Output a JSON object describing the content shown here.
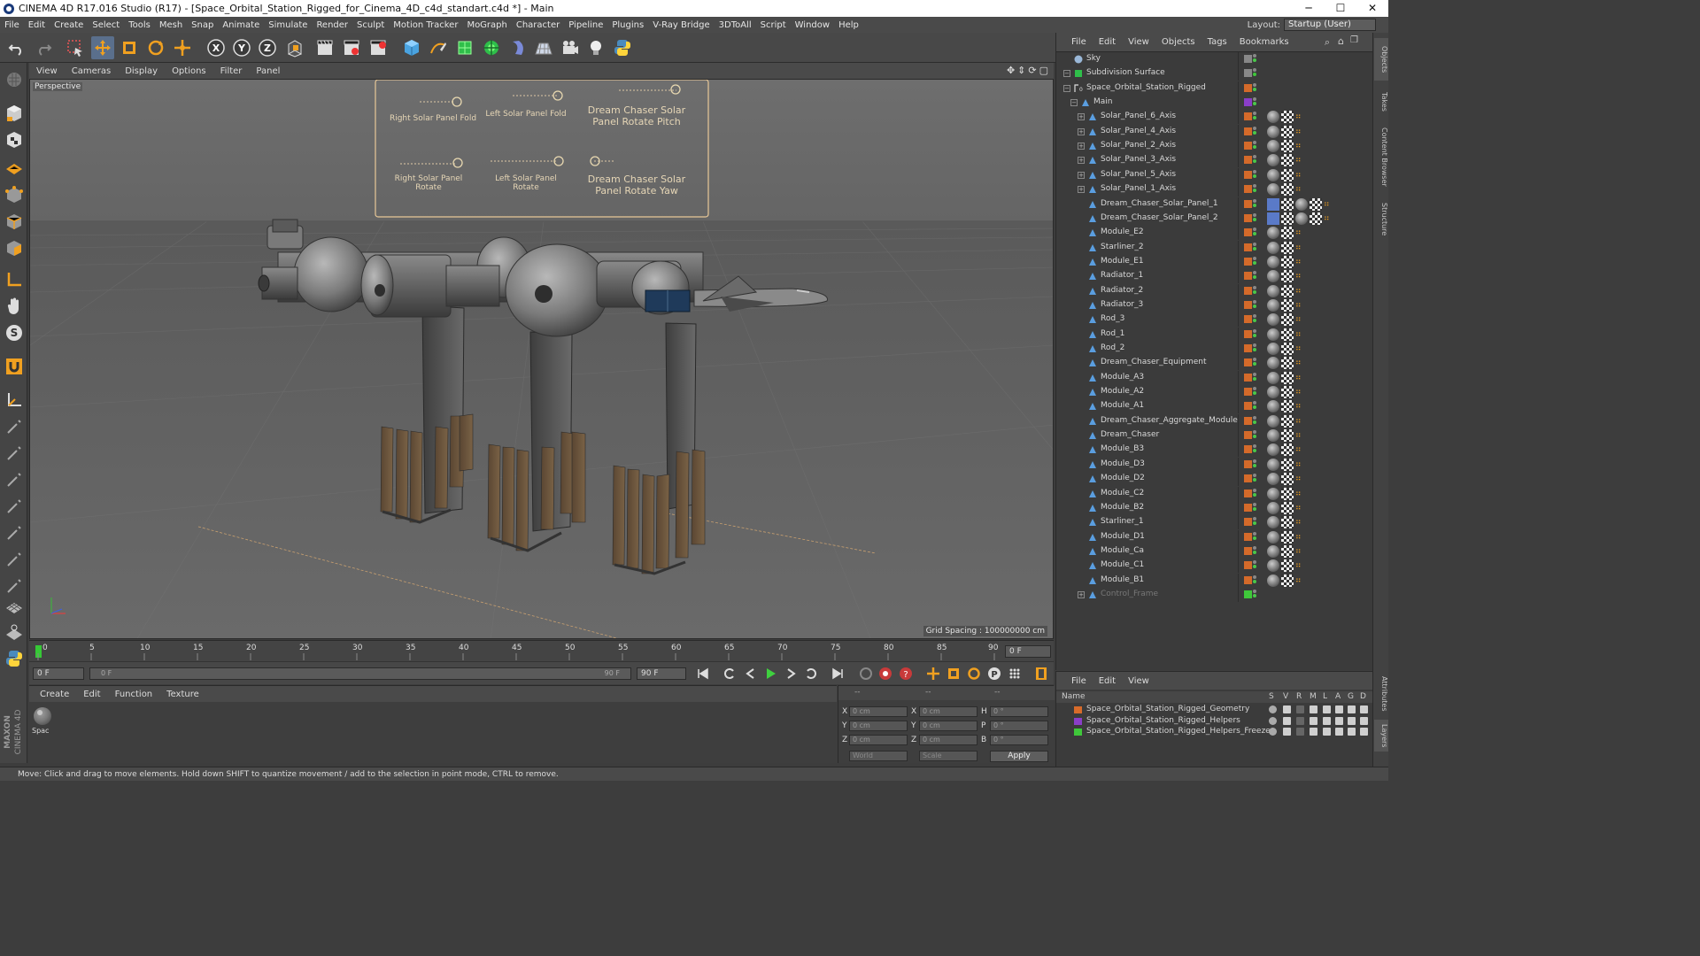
{
  "window": {
    "title": "CINEMA 4D R17.016 Studio (R17) - [Space_Orbital_Station_Rigged_for_Cinema_4D_c4d_standart.c4d *] - Main",
    "minimize": "─",
    "maximize": "☐",
    "close": "✕"
  },
  "menubar": {
    "items": [
      "File",
      "Edit",
      "Create",
      "Select",
      "Tools",
      "Mesh",
      "Snap",
      "Animate",
      "Simulate",
      "Render",
      "Sculpt",
      "Motion Tracker",
      "MoGraph",
      "Character",
      "Pipeline",
      "Plugins",
      "V-Ray Bridge",
      "3DToAll",
      "Script",
      "Window",
      "Help"
    ],
    "layout_label": "Layout:",
    "layout_value": "Startup (User)"
  },
  "viewport": {
    "menu": [
      "View",
      "Cameras",
      "Display",
      "Options",
      "Filter",
      "Panel"
    ],
    "camera": "Perspective",
    "grid_spacing": "Grid Spacing : 100000000 cm",
    "rig_labels": {
      "r1": "Right Solar Panel Fold",
      "r2": "Left Solar Panel Fold",
      "r3": "Dream Chaser Solar Panel Rotate Pitch",
      "r4": "Right Solar Panel Rotate",
      "r5": "Left Solar Panel Rotate",
      "r6": "Dream Chaser Solar Panel Rotate Yaw"
    }
  },
  "timeline": {
    "ticks": [
      "0",
      "5",
      "10",
      "15",
      "20",
      "25",
      "30",
      "35",
      "40",
      "45",
      "50",
      "55",
      "60",
      "65",
      "70",
      "75",
      "80",
      "85",
      "90"
    ],
    "current_frame": "0 F"
  },
  "transport": {
    "start_frame": "0 F",
    "range_start": "0 F",
    "range_end": "90 F",
    "end_frame": "90 F"
  },
  "material_panel": {
    "menu": [
      "Create",
      "Edit",
      "Function",
      "Texture"
    ],
    "material_name": "Spac"
  },
  "coords": {
    "x_pos": "0 cm",
    "y_pos": "0 cm",
    "z_pos": "0 cm",
    "x_size": "0 cm",
    "y_size": "0 cm",
    "z_size": "0 cm",
    "h": "0 °",
    "p": "0 °",
    "b": "0 °",
    "labels": {
      "x": "X",
      "y": "Y",
      "z": "Z",
      "h": "H",
      "p": "P",
      "b": "B"
    },
    "header_left": "--",
    "header_mid": "--",
    "header_right": "--",
    "mode": "World",
    "scale": "Scale",
    "apply": "Apply"
  },
  "status": "Move: Click and drag to move elements. Hold down SHIFT to quantize movement / add to the selection in point mode, CTRL to remove.",
  "objects_panel": {
    "menu": [
      "File",
      "Edit",
      "View",
      "Objects",
      "Tags",
      "Bookmarks"
    ],
    "rows": [
      {
        "name": "Sky",
        "indent": 0,
        "icon": "sky-icon"
      },
      {
        "name": "Subdivision Surface",
        "indent": 0,
        "icon": "subdivision-icon"
      },
      {
        "name": "Space_Orbital_Station_Rigged",
        "indent": 1,
        "icon": "null-icon"
      },
      {
        "name": "Main",
        "indent": 2,
        "icon": "joint-icon"
      },
      {
        "name": "Solar_Panel_6_Axis",
        "indent": 3,
        "icon": "joint-icon"
      },
      {
        "name": "Solar_Panel_4_Axis",
        "indent": 3,
        "icon": "joint-icon"
      },
      {
        "name": "Solar_Panel_2_Axis",
        "indent": 3,
        "icon": "joint-icon"
      },
      {
        "name": "Solar_Panel_3_Axis",
        "indent": 3,
        "icon": "joint-icon"
      },
      {
        "name": "Solar_Panel_5_Axis",
        "indent": 3,
        "icon": "joint-icon"
      },
      {
        "name": "Solar_Panel_1_Axis",
        "indent": 3,
        "icon": "joint-icon"
      },
      {
        "name": "Dream_Chaser_Solar_Panel_1",
        "indent": 3,
        "icon": "joint-icon"
      },
      {
        "name": "Dream_Chaser_Solar_Panel_2",
        "indent": 3,
        "icon": "joint-icon"
      },
      {
        "name": "Module_E2",
        "indent": 3,
        "icon": "joint-icon"
      },
      {
        "name": "Starliner_2",
        "indent": 3,
        "icon": "joint-icon"
      },
      {
        "name": "Module_E1",
        "indent": 3,
        "icon": "joint-icon"
      },
      {
        "name": "Radiator_1",
        "indent": 3,
        "icon": "joint-icon"
      },
      {
        "name": "Radiator_2",
        "indent": 3,
        "icon": "joint-icon"
      },
      {
        "name": "Radiator_3",
        "indent": 3,
        "icon": "joint-icon"
      },
      {
        "name": "Rod_3",
        "indent": 3,
        "icon": "joint-icon"
      },
      {
        "name": "Rod_1",
        "indent": 3,
        "icon": "joint-icon"
      },
      {
        "name": "Rod_2",
        "indent": 3,
        "icon": "joint-icon"
      },
      {
        "name": "Dream_Chaser_Equipment",
        "indent": 3,
        "icon": "joint-icon"
      },
      {
        "name": "Module_A3",
        "indent": 3,
        "icon": "joint-icon"
      },
      {
        "name": "Module_A2",
        "indent": 3,
        "icon": "joint-icon"
      },
      {
        "name": "Module_A1",
        "indent": 3,
        "icon": "joint-icon"
      },
      {
        "name": "Dream_Chaser_Aggregate_Module",
        "indent": 3,
        "icon": "joint-icon"
      },
      {
        "name": "Dream_Chaser",
        "indent": 3,
        "icon": "joint-icon"
      },
      {
        "name": "Module_B3",
        "indent": 3,
        "icon": "joint-icon"
      },
      {
        "name": "Module_D3",
        "indent": 3,
        "icon": "joint-icon"
      },
      {
        "name": "Module_D2",
        "indent": 3,
        "icon": "joint-icon"
      },
      {
        "name": "Module_C2",
        "indent": 3,
        "icon": "joint-icon"
      },
      {
        "name": "Module_B2",
        "indent": 3,
        "icon": "joint-icon"
      },
      {
        "name": "Starliner_1",
        "indent": 3,
        "icon": "joint-icon"
      },
      {
        "name": "Module_D1",
        "indent": 3,
        "icon": "joint-icon"
      },
      {
        "name": "Module_Ca",
        "indent": 3,
        "icon": "joint-icon"
      },
      {
        "name": "Module_C1",
        "indent": 3,
        "icon": "joint-icon"
      },
      {
        "name": "Module_B1",
        "indent": 3,
        "icon": "joint-icon"
      },
      {
        "name": "Control_Frame",
        "indent": 3,
        "icon": "joint-icon"
      }
    ]
  },
  "layers_panel": {
    "menu": [
      "File",
      "Edit",
      "View"
    ],
    "header": {
      "name": "Name",
      "cols": [
        "S",
        "V",
        "R",
        "M",
        "L",
        "A",
        "G",
        "D"
      ]
    },
    "rows": [
      {
        "name": "Space_Orbital_Station_Rigged_Geometry",
        "color": "#d86b2a"
      },
      {
        "name": "Space_Orbital_Station_Rigged_Helpers",
        "color": "#8a3ec8"
      },
      {
        "name": "Space_Orbital_Station_Rigged_Helpers_Freeze",
        "color": "#3fc83a"
      }
    ]
  },
  "right_tabs": [
    "Objects",
    "Takes",
    "Content Browser",
    "Structure",
    "Attributes",
    "Layers"
  ],
  "colors": {
    "accent_orange": "#d46a2a",
    "selection_blue": "#3c7fd0",
    "panel_bg": "#3b3b3b"
  }
}
